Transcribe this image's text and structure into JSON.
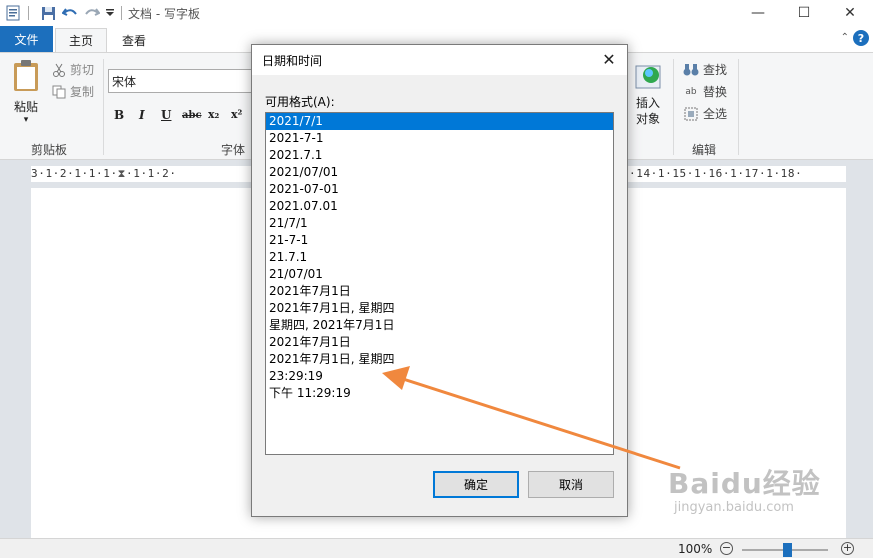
{
  "window": {
    "title": "文档 - 写字板",
    "min": "—",
    "max": "☐",
    "close": "✕"
  },
  "tabs": {
    "file": "文件",
    "home": "主页",
    "view": "查看"
  },
  "ribbon": {
    "paste": "粘贴",
    "paste_arrow": "▾",
    "cut": "剪切",
    "copy": "复制",
    "clipboard_group": "剪贴板",
    "font_name": "宋体",
    "font_group": "字体",
    "bold": "B",
    "italic": "I",
    "underline": "U",
    "strike": "abc",
    "subscript": "x₂",
    "superscript": "x²",
    "insert_object": [
      "插入",
      "对象"
    ],
    "find": "查找",
    "replace": "替换",
    "select_all": "全选",
    "edit_group": "编辑"
  },
  "ruler": {
    "left": "3·1·2·1·1·1·",
    "middle": "·1·1·2·",
    "right": "·14·1·15·1·16·1·17·1·18·"
  },
  "status": {
    "zoom": "100%",
    "zoom_out": "−",
    "zoom_in": "+"
  },
  "dialog": {
    "title": "日期和时间",
    "label": "可用格式(A):",
    "formats": [
      "2021/7/1",
      "2021-7-1",
      "2021.7.1",
      "2021/07/01",
      "2021-07-01",
      "2021.07.01",
      "21/7/1",
      "21-7-1",
      "21.7.1",
      "21/07/01",
      "2021年7月1日",
      "2021年7月1日, 星期四",
      "星期四, 2021年7月1日",
      "2021年7月1日",
      "2021年7月1日, 星期四",
      "23:29:19",
      "下午 11:29:19"
    ],
    "selected_index": 0,
    "ok": "确定",
    "cancel": "取消"
  },
  "watermark": {
    "main": "Baidu经验",
    "sub": "jingyan.baidu.com"
  },
  "colors": {
    "accent": "#1c6fbd",
    "selection": "#0078d7",
    "arrow": "#f0883e"
  }
}
